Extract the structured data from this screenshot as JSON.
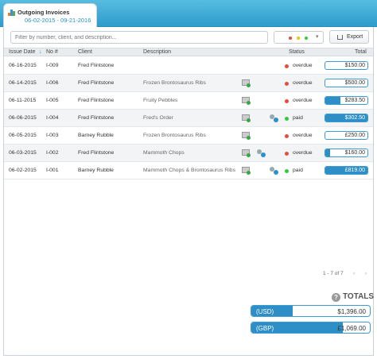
{
  "tab": {
    "title": "Outgoing Invoices",
    "date_range": "06-02-2015 - 09-21-2016"
  },
  "toolbar": {
    "search_placeholder": "Filter by number, client, and description...",
    "export_label": "Export",
    "status_dot_colors": [
      "#e74c3c",
      "#f1c40f",
      "#2ecc40"
    ]
  },
  "table": {
    "headers": {
      "issue_date": "Issue Date",
      "sort_arrow": "↓",
      "no": "No #",
      "client": "Client",
      "description": "Description",
      "status": "Status",
      "total": "Total"
    },
    "rows": [
      {
        "date": "06-16-2015",
        "no": "I-009",
        "client": "Fred Flintstone",
        "description": "",
        "status": "overdue",
        "total": "$150.00",
        "paid_fraction": 0.0,
        "envelope": false,
        "gear": false
      },
      {
        "date": "06-14-2015",
        "no": "I-006",
        "client": "Fred Flintstone",
        "description": "Frozen Brontosaurus Ribs",
        "status": "overdue",
        "total": "$500.00",
        "paid_fraction": 0.0,
        "envelope": true,
        "gear": false
      },
      {
        "date": "06-11-2015",
        "no": "I-005",
        "client": "Fred Flintstone",
        "description": "Fruity Pebbles",
        "status": "overdue",
        "total": "$283.50",
        "paid_fraction": 0.35,
        "envelope": true,
        "gear": false
      },
      {
        "date": "06-06-2015",
        "no": "I-004",
        "client": "Fred Flintstone",
        "description": "Fred's Order",
        "status": "paid",
        "total": "$302.50",
        "paid_fraction": 1.0,
        "envelope": true,
        "gear": true
      },
      {
        "date": "06-05-2015",
        "no": "I-003",
        "client": "Barney Rubble",
        "description": "Frozen Brontosaurus Ribs",
        "status": "overdue",
        "total": "£250.00",
        "paid_fraction": 0.0,
        "envelope": true,
        "gear": false
      },
      {
        "date": "06-03-2015",
        "no": "I-002",
        "client": "Fred Flintstone",
        "description": "Mammoth Chops",
        "status": "overdue",
        "total": "$160.00",
        "paid_fraction": 0.12,
        "envelope": true,
        "gear": true
      },
      {
        "date": "06-02-2015",
        "no": "I-001",
        "client": "Barney Rubble",
        "description": "Mammoth Chops & Brontosaurus Ribs",
        "status": "paid",
        "total": "£819.00",
        "paid_fraction": 1.0,
        "envelope": true,
        "gear": true
      }
    ]
  },
  "pager": {
    "text": "1 - 7 of 7",
    "prev": "‹",
    "next": "›"
  },
  "totals": {
    "heading": "TOTALS",
    "help": "?",
    "items": [
      {
        "currency": "(USD)",
        "amount": "$1,396.00",
        "paid_fraction": 0.35
      },
      {
        "currency": "(GBP)",
        "amount": "£1,069.00",
        "paid_fraction": 0.77
      }
    ]
  }
}
